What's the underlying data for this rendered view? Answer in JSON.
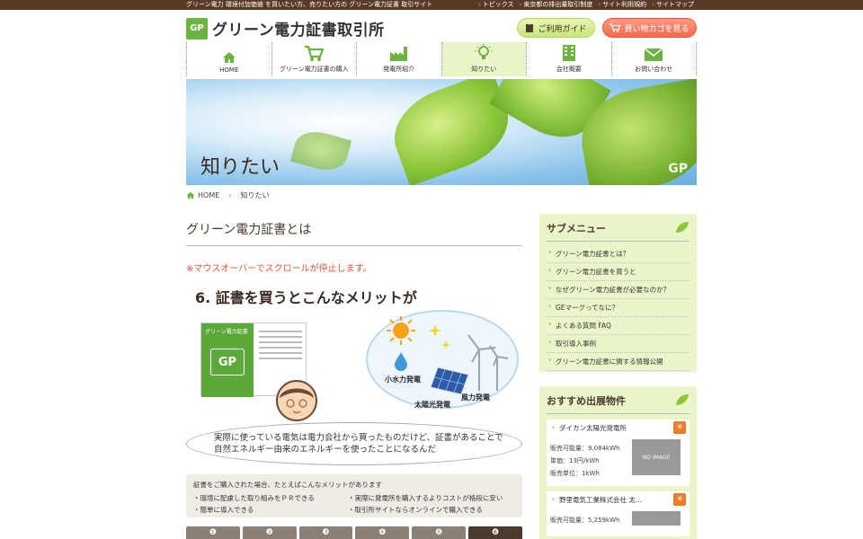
{
  "topbar": {
    "tagline": "グリーン電力 環境付加価値 を買いたい方、売りたい方の グリーン電力証書 取引サイト",
    "links": [
      "トピックス",
      "東京都の排出量取引制度",
      "サイト利用規約",
      "サイトマップ"
    ]
  },
  "logo": {
    "mark": "GP",
    "name": "グリーン電力証書取引所"
  },
  "header": {
    "guide_label": "ご利用ガイド",
    "cart_label": "買い物カゴを見る"
  },
  "gnav": [
    {
      "label": "HOME",
      "icon": "house-icon"
    },
    {
      "label": "グリーン電力証書の購入",
      "icon": "cart-icon"
    },
    {
      "label": "発電所紹介",
      "icon": "factory-icon"
    },
    {
      "label": "知りたい",
      "icon": "lightbulb-icon"
    },
    {
      "label": "会社概要",
      "icon": "building-icon"
    },
    {
      "label": "お問い合わせ",
      "icon": "mail-icon"
    }
  ],
  "hero": {
    "title": "知りたい",
    "mark": "GP"
  },
  "breadcrumb": {
    "home": "HOME",
    "current": "知りたい"
  },
  "main": {
    "heading": "グリーン電力証書とは",
    "note": "※マウスオーバーでスクロールが停止します。",
    "subheading": "6. 証書を買うとこんなメリットが",
    "certificate": {
      "title": "グリーン電力証書",
      "mark": "GP"
    },
    "cloud_labels": {
      "hydro": "小水力発電",
      "wind": "風力発電",
      "solar": "太陽光発電"
    },
    "speech_line1": "実際に使っている電気は電力会社から買ったものだけど、証書があることで",
    "speech_line2": "自然エネルギー由来のエネルギーを使ったことになるんだ",
    "benefit_title": "証書をご購入された場合、たとえばこんなメリットがあります",
    "benefits": [
      "・環境に配慮した取り組みをＰＲできる",
      "・実際に発電所を購入するよりコストが格段に安い",
      "・簡単に導入できる",
      "・取引所サイトならオンラインで購入できる"
    ],
    "steps": [
      "❶",
      "❷",
      "❸",
      "❹",
      "❺",
      "❻"
    ]
  },
  "sidebar": {
    "submenu_title": "サブメニュー",
    "submenu": [
      "グリーン電力証書とは？",
      "グリーン電力証書を買うと",
      "なぜグリーン電力証書が必要なのか？",
      "GEマークってなに？",
      "よくある質問 FAQ",
      "取引導入事例",
      "グリーン電力証書に関する情報公開"
    ],
    "recommend_title": "おすすめ出展物件",
    "properties": [
      {
        "name": "ダイカン太陽光発電所",
        "capacity": "販売可能量：9,084kWh",
        "price": "単価：13円/kWh",
        "unit": "販売単位：1kWh",
        "image": "NO IMAGE"
      },
      {
        "name": "野里電気工業株式会社 太...",
        "capacity": "販売可能量：5,259kWh",
        "image": ""
      }
    ]
  },
  "colors": {
    "brand_green": "#6cb33f",
    "topbar_brown": "#5a3a26",
    "accent_red": "#e0533a",
    "side_bg": "#eaf6c9"
  }
}
